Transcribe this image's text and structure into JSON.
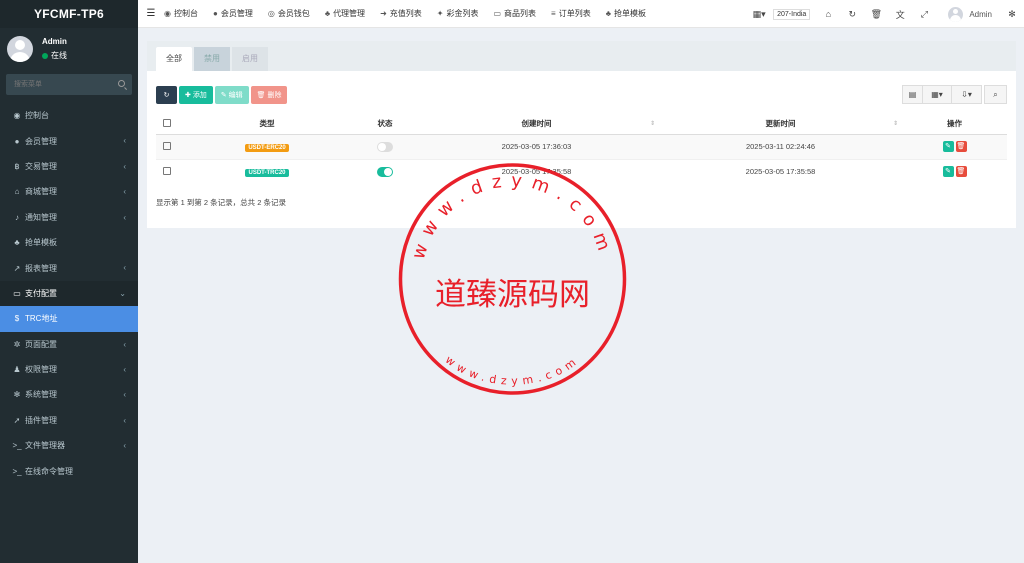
{
  "brand": "YFCMF-TP6",
  "user": {
    "name": "Admin",
    "status": "在线"
  },
  "sidebar": {
    "search_placeholder": "搜索菜单",
    "items": [
      {
        "label": "控制台",
        "icon": "dashboard-icon",
        "glyph": "◉",
        "chevron": false
      },
      {
        "label": "会员管理",
        "icon": "user-icon",
        "glyph": "●",
        "chevron": true
      },
      {
        "label": "交易管理",
        "icon": "bitcoin-icon",
        "glyph": "฿",
        "chevron": true
      },
      {
        "label": "商城管理",
        "icon": "home-icon",
        "glyph": "⌂",
        "chevron": true
      },
      {
        "label": "通知管理",
        "icon": "bell-icon",
        "glyph": "♪",
        "chevron": true
      },
      {
        "label": "抢单模板",
        "icon": "sitemap-icon",
        "glyph": "♣",
        "chevron": false
      },
      {
        "label": "报表管理",
        "icon": "line-chart-icon",
        "glyph": "↗",
        "chevron": true
      },
      {
        "label": "支付配置",
        "icon": "credit-card-icon",
        "glyph": "▭",
        "chevron": true,
        "open": true
      },
      {
        "label": "TRC地址",
        "icon": "dollar-icon",
        "glyph": "$",
        "chevron": false,
        "active": true
      },
      {
        "label": "页面配置",
        "icon": "gear-icon",
        "glyph": "✲",
        "chevron": true
      },
      {
        "label": "权限管理",
        "icon": "users-icon",
        "glyph": "♟",
        "chevron": true
      },
      {
        "label": "系统管理",
        "icon": "cogs-icon",
        "glyph": "✻",
        "chevron": true
      },
      {
        "label": "插件管理",
        "icon": "rocket-icon",
        "glyph": "➚",
        "chevron": true
      },
      {
        "label": "文件管理器",
        "icon": "terminal-icon",
        "glyph": ">_",
        "chevron": true
      },
      {
        "label": "在线命令管理",
        "icon": "terminal-icon",
        "glyph": ">_",
        "chevron": false
      }
    ]
  },
  "topnav": {
    "items": [
      {
        "label": "控制台",
        "icon": "dashboard-icon",
        "glyph": "◉"
      },
      {
        "label": "会员管理",
        "icon": "user-icon",
        "glyph": "●"
      },
      {
        "label": "会员钱包",
        "icon": "wallet-icon",
        "glyph": "◎"
      },
      {
        "label": "代理管理",
        "icon": "sitemap-icon",
        "glyph": "♣"
      },
      {
        "label": "充值列表",
        "icon": "sign-in-icon",
        "glyph": "➜"
      },
      {
        "label": "彩金列表",
        "icon": "gift-icon",
        "glyph": "✦"
      },
      {
        "label": "商品列表",
        "icon": "desktop-icon",
        "glyph": "▭"
      },
      {
        "label": "订单列表",
        "icon": "list-icon",
        "glyph": "≡"
      },
      {
        "label": "抢单模板",
        "icon": "sitemap-icon",
        "glyph": "♣"
      }
    ],
    "site_label": "207-India",
    "user_name": "Admin"
  },
  "tabs": [
    "全部",
    "禁用",
    "启用"
  ],
  "toolbar": {
    "add": "添加",
    "edit": "编辑",
    "delete": "删除"
  },
  "table": {
    "headers": [
      "类型",
      "状态",
      "创建时间",
      "更新时间",
      "操作"
    ],
    "rows": [
      {
        "type": "USDT-ERC20",
        "type_color": "#f39c12",
        "enabled": false,
        "created": "2025-03-05 17:36:03",
        "updated": "2025-03-11 02:24:46"
      },
      {
        "type": "USDT-TRC20",
        "type_color": "#18bc9c",
        "enabled": true,
        "created": "2025-03-05 17:35:58",
        "updated": "2025-03-05 17:35:58"
      }
    ]
  },
  "page_info": "显示第 1 到第 2 条记录，总共 2 条记录",
  "seal": {
    "center_text": "道臻源码网",
    "outer_text": "www.dzym.com",
    "inner_text": "www.dzym.com",
    "color": "#e8202a"
  }
}
